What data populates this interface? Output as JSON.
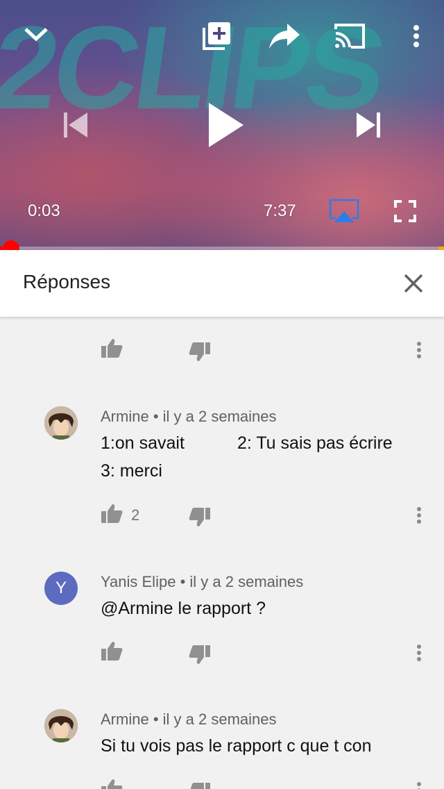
{
  "player": {
    "current_time": "0:03",
    "duration": "7:37",
    "progress": 0.007,
    "background_text": "2CLIPS",
    "icons": {
      "collapse": "chevron-down-icon",
      "add_to_playlist": "playlist-add-icon",
      "share": "share-icon",
      "cast": "cast-icon",
      "more": "more-vert-icon",
      "previous": "skip-previous-icon",
      "play": "play-icon",
      "next": "skip-next-icon",
      "airplay": "airplay-icon",
      "fullscreen": "fullscreen-icon"
    },
    "colors": {
      "progress": "#ff0000",
      "airplay": "#2b7de9"
    }
  },
  "panel": {
    "title": "Réponses",
    "close_icon": "close-icon"
  },
  "comments": [
    {
      "author": "",
      "time": "",
      "lines": [],
      "likes": ""
    },
    {
      "author": "Armine",
      "time": "il y a 2 semaines",
      "lines": [
        "1:on savait",
        "2: Tu sais pas écrire",
        "3: merci"
      ],
      "likes": "2"
    },
    {
      "author": "Yanis Elipe",
      "avatar_letter": "Y",
      "avatar_color": "#5c6bc0",
      "time": "il y a 2 semaines",
      "lines": [
        "@Armine le rapport ?"
      ],
      "likes": ""
    },
    {
      "author": "Armine",
      "time": "il y a 2 semaines",
      "lines": [
        "Si tu vois pas le rapport c que t con"
      ],
      "likes": ""
    }
  ],
  "meta_separator": "•"
}
